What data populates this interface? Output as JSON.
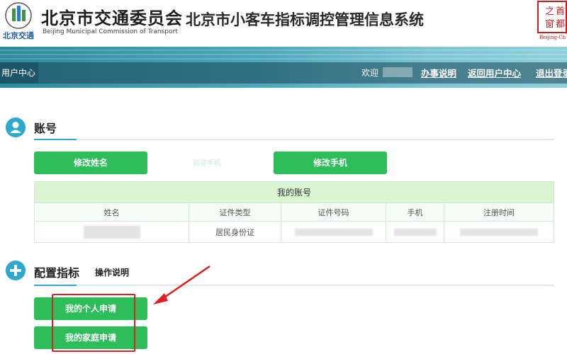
{
  "header": {
    "org_name_cn": "北京市交通委员会",
    "org_name_en": "Beijing Municipal Commission of Transport",
    "system_title": "北京市小客车指标调控管理信息系统",
    "logo_text": "北京交通",
    "seal_text": "之首都窗"
  },
  "nav": {
    "user_center_tab": "用户中心",
    "welcome": "欢迎",
    "links": [
      "办事说明",
      "返回用户中心",
      "退出登录"
    ]
  },
  "account_section": {
    "title": "账号",
    "edit_name_button": "修改姓名",
    "edit_phone_button": "修改手机",
    "faint_text": "验证手机",
    "table": {
      "caption": "我的账号",
      "columns": [
        "姓名",
        "证件类型",
        "证件号码",
        "手机",
        "注册时间"
      ],
      "rows": [
        {
          "name": "",
          "id_type": "居民身份证",
          "id_number": "",
          "phone": "",
          "registered": ""
        }
      ]
    }
  },
  "config_section": {
    "title": "配置指标",
    "ops_link": "操作说明",
    "personal_apply_button": "我的个人申请",
    "family_apply_button": "我的家庭申请"
  },
  "colors": {
    "primary_green": "#2dbe5a",
    "section_blue": "#2fa8cf",
    "banner_teal": "#2d8a9c",
    "highlight_red": "#e02020"
  }
}
